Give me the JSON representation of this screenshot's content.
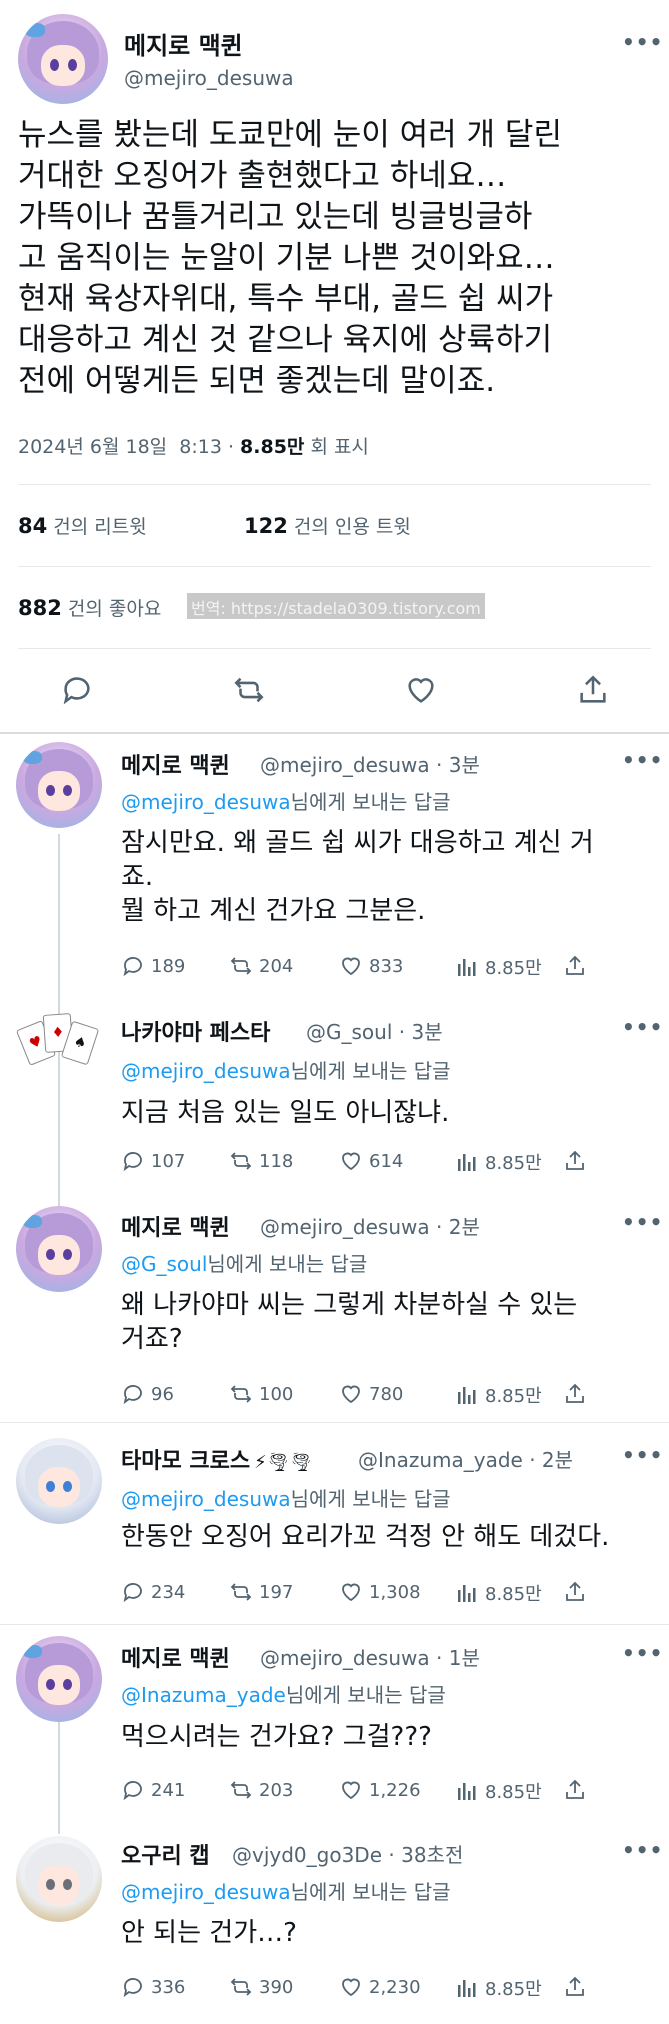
{
  "tweet": {
    "author_name": "메지로 맥퀸",
    "author_handle": "@mejiro_desuwa",
    "more_icon": "more-dots-icon",
    "body_lines": [
      "뉴스를 봤는데 도쿄만에 눈이 여러 개 달린",
      "거대한 오징어가 출현했다고 하네요…",
      "가뜩이나 꿈틀거리고 있는데 빙글빙글하",
      "고 움직이는 눈알이 기분 나쁜 것이와요…",
      "현재 육상자위대, 특수 부대, 골드 쉽 씨가",
      "대응하고 계신 것 같으나 육지에 상륙하기",
      "전에 어떻게든 되면 좋겠는데 말이죠."
    ],
    "date": "2024년 6월 18일",
    "time": "8:13",
    "views": "8.85만",
    "views_label": "회 표시",
    "retweets": "84",
    "retweets_label": "건의 리트윗",
    "quotes": "122",
    "quotes_label": "건의 인용 트윗",
    "likes": "882",
    "likes_label": "건의 좋아요",
    "watermark": "번역: https://stadela0309.tistory.com"
  },
  "replies": [
    {
      "name": "메지로 맥퀸",
      "badges": "",
      "handle": "@mejiro_desuwa",
      "time": "3분",
      "mention": "@mejiro_desuwa",
      "replying_suffix": "님에게 보내는 답글",
      "text_lines": [
        "잠시만요. 왜 골드 쉽 씨가 대응하고 계신 거",
        "죠.",
        "뭘 하고 계신 건가요 그분은."
      ],
      "reply_count": "189",
      "retweet_count": "204",
      "like_count": "833",
      "view_count": "8.85만"
    },
    {
      "name": "나카야마 페스타",
      "badges": "",
      "handle": "@G_soul",
      "time": "3분",
      "mention": "@mejiro_desuwa",
      "replying_suffix": "님에게 보내는 답글",
      "text_lines": [
        "지금 처음 있는 일도 아니잖냐."
      ],
      "reply_count": "107",
      "retweet_count": "118",
      "like_count": "614",
      "view_count": "8.85만"
    },
    {
      "name": "메지로 맥퀸",
      "badges": "",
      "handle": "@mejiro_desuwa",
      "time": "2분",
      "mention": "@G_soul",
      "replying_suffix": "님에게 보내는 답글",
      "text_lines": [
        "왜 나카야마 씨는 그렇게 차분하실 수 있는",
        "거죠?"
      ],
      "reply_count": "96",
      "retweet_count": "100",
      "like_count": "780",
      "view_count": "8.85만"
    },
    {
      "name": "타마모 크로스",
      "badges": "⚡🌪🌪",
      "handle": "@Inazuma_yade",
      "time": "2분",
      "mention": "@mejiro_desuwa",
      "replying_suffix": "님에게 보내는 답글",
      "text_lines": [
        "한동안 오징어 요리가꼬 걱정 안 해도 데겄다."
      ],
      "reply_count": "234",
      "retweet_count": "197",
      "like_count": "1,308",
      "view_count": "8.85만"
    },
    {
      "name": "메지로 맥퀸",
      "badges": "",
      "handle": "@mejiro_desuwa",
      "time": "1분",
      "mention": "@Inazuma_yade",
      "replying_suffix": "님에게 보내는 답글",
      "text_lines": [
        "먹으시려는 건가요? 그걸???"
      ],
      "reply_count": "241",
      "retweet_count": "203",
      "like_count": "1,226",
      "view_count": "8.85만"
    },
    {
      "name": "오구리 캡",
      "badges": "",
      "handle": "@vjyd0_go3De",
      "time": "38초전",
      "mention": "@mejiro_desuwa",
      "replying_suffix": "님에게 보내는 답글",
      "text_lines": [
        "안 되는 건가…?"
      ],
      "reply_count": "336",
      "retweet_count": "390",
      "like_count": "2,230",
      "view_count": "8.85만"
    }
  ],
  "colors": {
    "accent": "#1d9bf0",
    "text": "#0f1419",
    "muted": "#536471"
  },
  "icons": [
    "reply-icon",
    "retweet-icon",
    "like-icon",
    "share-icon",
    "views-icon",
    "more-dots-icon"
  ]
}
